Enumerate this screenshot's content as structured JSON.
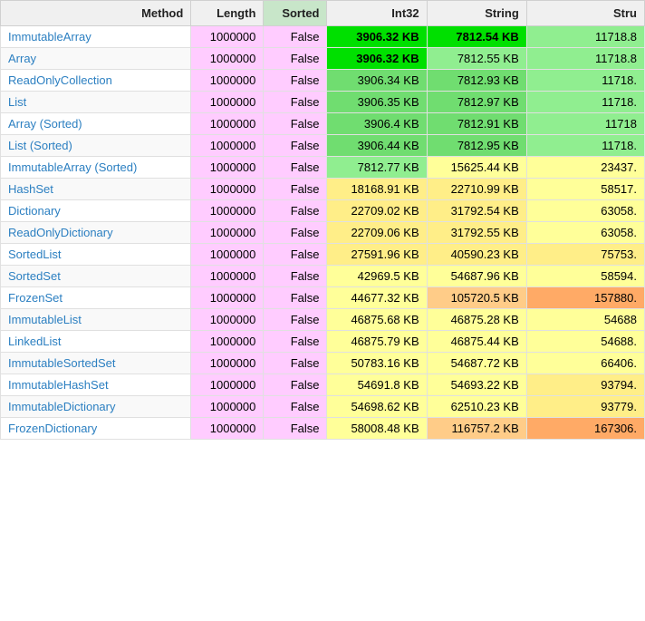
{
  "table": {
    "columns": [
      {
        "key": "method",
        "label": "Method",
        "class": "col-method"
      },
      {
        "key": "length",
        "label": "Length",
        "class": "col-length"
      },
      {
        "key": "sorted",
        "label": "Sorted",
        "class": "col-sorted"
      },
      {
        "key": "int32",
        "label": "Int32",
        "class": "col-int32"
      },
      {
        "key": "string",
        "label": "String",
        "class": "col-string"
      },
      {
        "key": "struct",
        "label": "Stru",
        "class": "col-struct"
      }
    ],
    "rows": [
      {
        "method": "ImmutableArray",
        "length": "1000000",
        "sorted": "False",
        "int32": "3906.32 KB",
        "string": "7812.54 KB",
        "struct": "11718.8",
        "int32_cls": "c-green-bright",
        "string_cls": "c-green-bright",
        "struct_cls": "c-green-light"
      },
      {
        "method": "Array",
        "length": "1000000",
        "sorted": "False",
        "int32": "3906.32 KB",
        "string": "7812.55 KB",
        "struct": "11718.8",
        "int32_cls": "c-green-bright",
        "string_cls": "c-green-light",
        "struct_cls": "c-green-light"
      },
      {
        "method": "ReadOnlyCollection",
        "length": "1000000",
        "sorted": "False",
        "int32": "3906.34 KB",
        "string": "7812.93 KB",
        "struct": "11718.",
        "int32_cls": "c-green-med",
        "string_cls": "c-green-med",
        "struct_cls": "c-green-light"
      },
      {
        "method": "List",
        "length": "1000000",
        "sorted": "False",
        "int32": "3906.35 KB",
        "string": "7812.97 KB",
        "struct": "11718.",
        "int32_cls": "c-green-med",
        "string_cls": "c-green-med",
        "struct_cls": "c-green-light"
      },
      {
        "method": "Array (Sorted)",
        "length": "1000000",
        "sorted": "False",
        "int32": "3906.4 KB",
        "string": "7812.91 KB",
        "struct": "11718",
        "int32_cls": "c-green-med",
        "string_cls": "c-green-med",
        "struct_cls": "c-green-light"
      },
      {
        "method": "List (Sorted)",
        "length": "1000000",
        "sorted": "False",
        "int32": "3906.44 KB",
        "string": "7812.95 KB",
        "struct": "11718.",
        "int32_cls": "c-green-med",
        "string_cls": "c-green-med",
        "struct_cls": "c-green-light"
      },
      {
        "method": "ImmutableArray (Sorted)",
        "length": "1000000",
        "sorted": "False",
        "int32": "7812.77 KB",
        "string": "15625.44 KB",
        "struct": "23437.",
        "int32_cls": "c-green-light",
        "string_cls": "c-yellow-light",
        "struct_cls": "c-yellow-light"
      },
      {
        "method": "HashSet",
        "length": "1000000",
        "sorted": "False",
        "int32": "18168.91 KB",
        "string": "22710.99 KB",
        "struct": "58517.",
        "int32_cls": "c-yellow-med",
        "string_cls": "c-yellow-med",
        "struct_cls": "c-yellow-light"
      },
      {
        "method": "Dictionary",
        "length": "1000000",
        "sorted": "False",
        "int32": "22709.02 KB",
        "string": "31792.54 KB",
        "struct": "63058.",
        "int32_cls": "c-yellow-med",
        "string_cls": "c-yellow-med",
        "struct_cls": "c-yellow-light"
      },
      {
        "method": "ReadOnlyDictionary",
        "length": "1000000",
        "sorted": "False",
        "int32": "22709.06 KB",
        "string": "31792.55 KB",
        "struct": "63058.",
        "int32_cls": "c-yellow-med",
        "string_cls": "c-yellow-med",
        "struct_cls": "c-yellow-light"
      },
      {
        "method": "SortedList",
        "length": "1000000",
        "sorted": "False",
        "int32": "27591.96 KB",
        "string": "40590.23 KB",
        "struct": "75753.",
        "int32_cls": "c-yellow-med",
        "string_cls": "c-yellow-med",
        "struct_cls": "c-yellow-med"
      },
      {
        "method": "SortedSet",
        "length": "1000000",
        "sorted": "False",
        "int32": "42969.5 KB",
        "string": "54687.96 KB",
        "struct": "58594.",
        "int32_cls": "c-yellow-light",
        "string_cls": "c-yellow-light",
        "struct_cls": "c-yellow-light"
      },
      {
        "method": "FrozenSet",
        "length": "1000000",
        "sorted": "False",
        "int32": "44677.32 KB",
        "string": "105720.5 KB",
        "struct": "157880.",
        "int32_cls": "c-yellow-light",
        "string_cls": "c-orange-light",
        "struct_cls": "c-orange-med"
      },
      {
        "method": "ImmutableList",
        "length": "1000000",
        "sorted": "False",
        "int32": "46875.68 KB",
        "string": "46875.28 KB",
        "struct": "54688",
        "int32_cls": "c-yellow-light",
        "string_cls": "c-yellow-light",
        "struct_cls": "c-yellow-light"
      },
      {
        "method": "LinkedList",
        "length": "1000000",
        "sorted": "False",
        "int32": "46875.79 KB",
        "string": "46875.44 KB",
        "struct": "54688.",
        "int32_cls": "c-yellow-light",
        "string_cls": "c-yellow-light",
        "struct_cls": "c-yellow-light"
      },
      {
        "method": "ImmutableSortedSet",
        "length": "1000000",
        "sorted": "False",
        "int32": "50783.16 KB",
        "string": "54687.72 KB",
        "struct": "66406.",
        "int32_cls": "c-yellow-light",
        "string_cls": "c-yellow-light",
        "struct_cls": "c-yellow-light"
      },
      {
        "method": "ImmutableHashSet",
        "length": "1000000",
        "sorted": "False",
        "int32": "54691.8 KB",
        "string": "54693.22 KB",
        "struct": "93794.",
        "int32_cls": "c-yellow-light",
        "string_cls": "c-yellow-light",
        "struct_cls": "c-yellow-med"
      },
      {
        "method": "ImmutableDictionary",
        "length": "1000000",
        "sorted": "False",
        "int32": "54698.62 KB",
        "string": "62510.23 KB",
        "struct": "93779.",
        "int32_cls": "c-yellow-light",
        "string_cls": "c-yellow-light",
        "struct_cls": "c-yellow-med"
      },
      {
        "method": "FrozenDictionary",
        "length": "1000000",
        "sorted": "False",
        "int32": "58008.48 KB",
        "string": "116757.2 KB",
        "struct": "167306.",
        "int32_cls": "c-yellow-light",
        "string_cls": "c-orange-light",
        "struct_cls": "c-orange-med"
      }
    ]
  }
}
